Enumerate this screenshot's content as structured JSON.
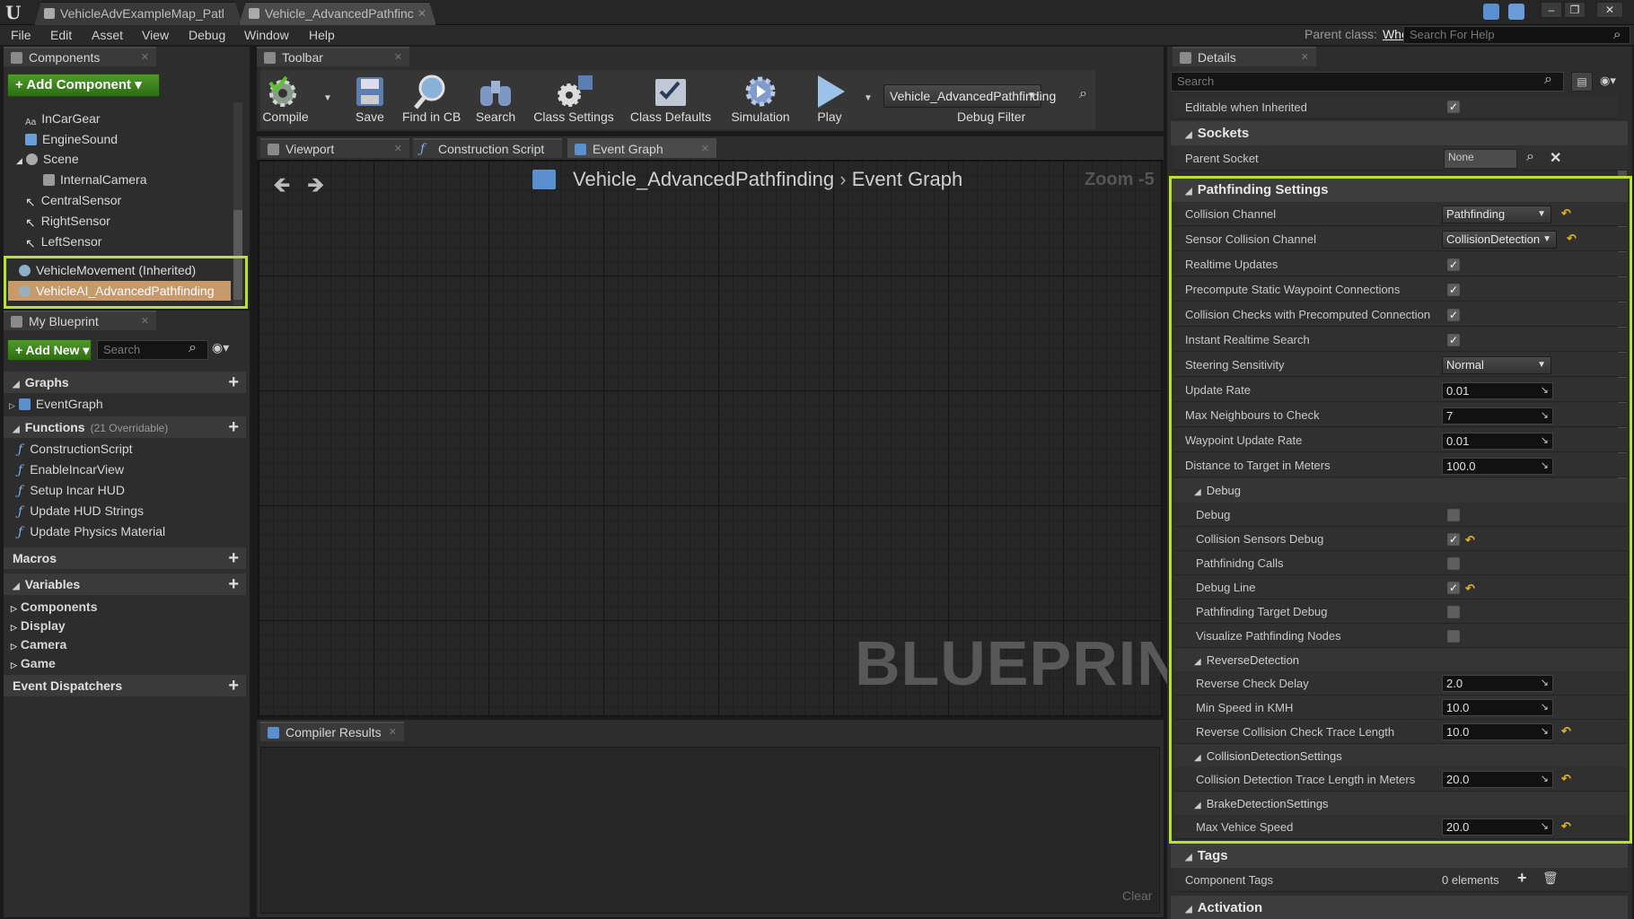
{
  "window": {
    "tabs": [
      {
        "label": "VehicleAdvExampleMap_Patl"
      },
      {
        "label": "Vehicle_AdvancedPathfinc"
      }
    ],
    "parent_class_label": "Parent class:",
    "parent_class_value": "Wheeled Vehicle",
    "help_search_placeholder": "Search For Help"
  },
  "menu": [
    "File",
    "Edit",
    "Asset",
    "View",
    "Debug",
    "Window",
    "Help"
  ],
  "components": {
    "tab": "Components",
    "add_button": "+ Add Component",
    "items": [
      "InCarGear",
      "EngineSound",
      "Scene",
      "InternalCamera",
      "CentralSensor",
      "RightSensor",
      "LeftSensor",
      "VehicleMovement (Inherited)",
      "VehicleAI_AdvancedPathfinding"
    ]
  },
  "my_blueprint": {
    "tab": "My Blueprint",
    "add_new": "+ Add New",
    "search_placeholder": "Search",
    "graphs_label": "Graphs",
    "graphs": [
      "EventGraph"
    ],
    "functions_label": "Functions",
    "functions_note": "(21 Overridable)",
    "functions": [
      "ConstructionScript",
      "EnableIncarView",
      "Setup Incar HUD",
      "Update HUD Strings",
      "Update Physics Material"
    ],
    "macros_label": "Macros",
    "variables_label": "Variables",
    "variable_groups": [
      "Components",
      "Display",
      "Camera",
      "Game"
    ],
    "dispatchers_label": "Event Dispatchers"
  },
  "toolbar": {
    "tab": "Toolbar",
    "buttons": [
      "Compile",
      "Save",
      "Find in CB",
      "Search",
      "Class Settings",
      "Class Defaults",
      "Simulation",
      "Play"
    ],
    "debug_object": "Vehicle_AdvancedPathfinding",
    "debug_filter": "Debug Filter"
  },
  "editor_tabs": [
    "Viewport",
    "Construction Script",
    "Event Graph"
  ],
  "graph": {
    "breadcrumb_root": "Vehicle_AdvancedPathfinding",
    "breadcrumb_leaf": "Event Graph",
    "zoom": "Zoom -5",
    "watermark": "BLUEPRINT"
  },
  "compiler": {
    "tab": "Compiler Results",
    "clear": "Clear"
  },
  "details": {
    "tab": "Details",
    "search_placeholder": "Search",
    "editable_inherited": "Editable when Inherited",
    "sockets_label": "Sockets",
    "parent_socket_label": "Parent Socket",
    "parent_socket_value": "None",
    "pathfinding_label": "Pathfinding Settings",
    "collision_channel_label": "Collision Channel",
    "collision_channel_value": "Pathfinding",
    "sensor_channel_label": "Sensor Collision Channel",
    "sensor_channel_value": "CollisionDetection",
    "realtime_updates": "Realtime Updates",
    "precompute": "Precompute Static Waypoint Connections",
    "collision_checks": "Collision Checks with Precomputed Connection",
    "instant_search": "Instant Realtime Search",
    "steering_label": "Steering Sensitivity",
    "steering_value": "Normal",
    "update_rate_label": "Update Rate",
    "update_rate_value": "0.01",
    "max_neighbours_label": "Max Neighbours to Check",
    "max_neighbours_value": "7",
    "waypoint_rate_label": "Waypoint Update Rate",
    "waypoint_rate_value": "0.01",
    "distance_label": "Distance to Target in Meters",
    "distance_value": "100.0",
    "debug_group": "Debug",
    "debug_items": [
      "Debug",
      "Collision Sensors Debug",
      "Pathfinidng Calls",
      "Debug Line",
      "Pathfinding Target Debug",
      "Visualize Pathfinding Nodes"
    ],
    "reverse_group": "ReverseDetection",
    "reverse_delay_label": "Reverse Check Delay",
    "reverse_delay_value": "2.0",
    "min_speed_label": "Min Speed in KMH",
    "min_speed_value": "10.0",
    "reverse_trace_label": "Reverse Collision Check Trace Length",
    "reverse_trace_value": "10.0",
    "collision_group": "CollisionDetectionSettings",
    "collision_trace_label": "Collision Detection Trace Length in Meters",
    "collision_trace_value": "20.0",
    "brake_group": "BrakeDetectionSettings",
    "max_speed_label": "Max Vehice Speed",
    "max_speed_value": "20.0",
    "tags_label": "Tags",
    "component_tags_label": "Component Tags",
    "component_tags_value": "0 elements",
    "activation_label": "Activation"
  },
  "colors": {
    "highlight": "#b8e22f",
    "green_button": "#3f8a1f",
    "reset_arrow": "#e0b020"
  }
}
